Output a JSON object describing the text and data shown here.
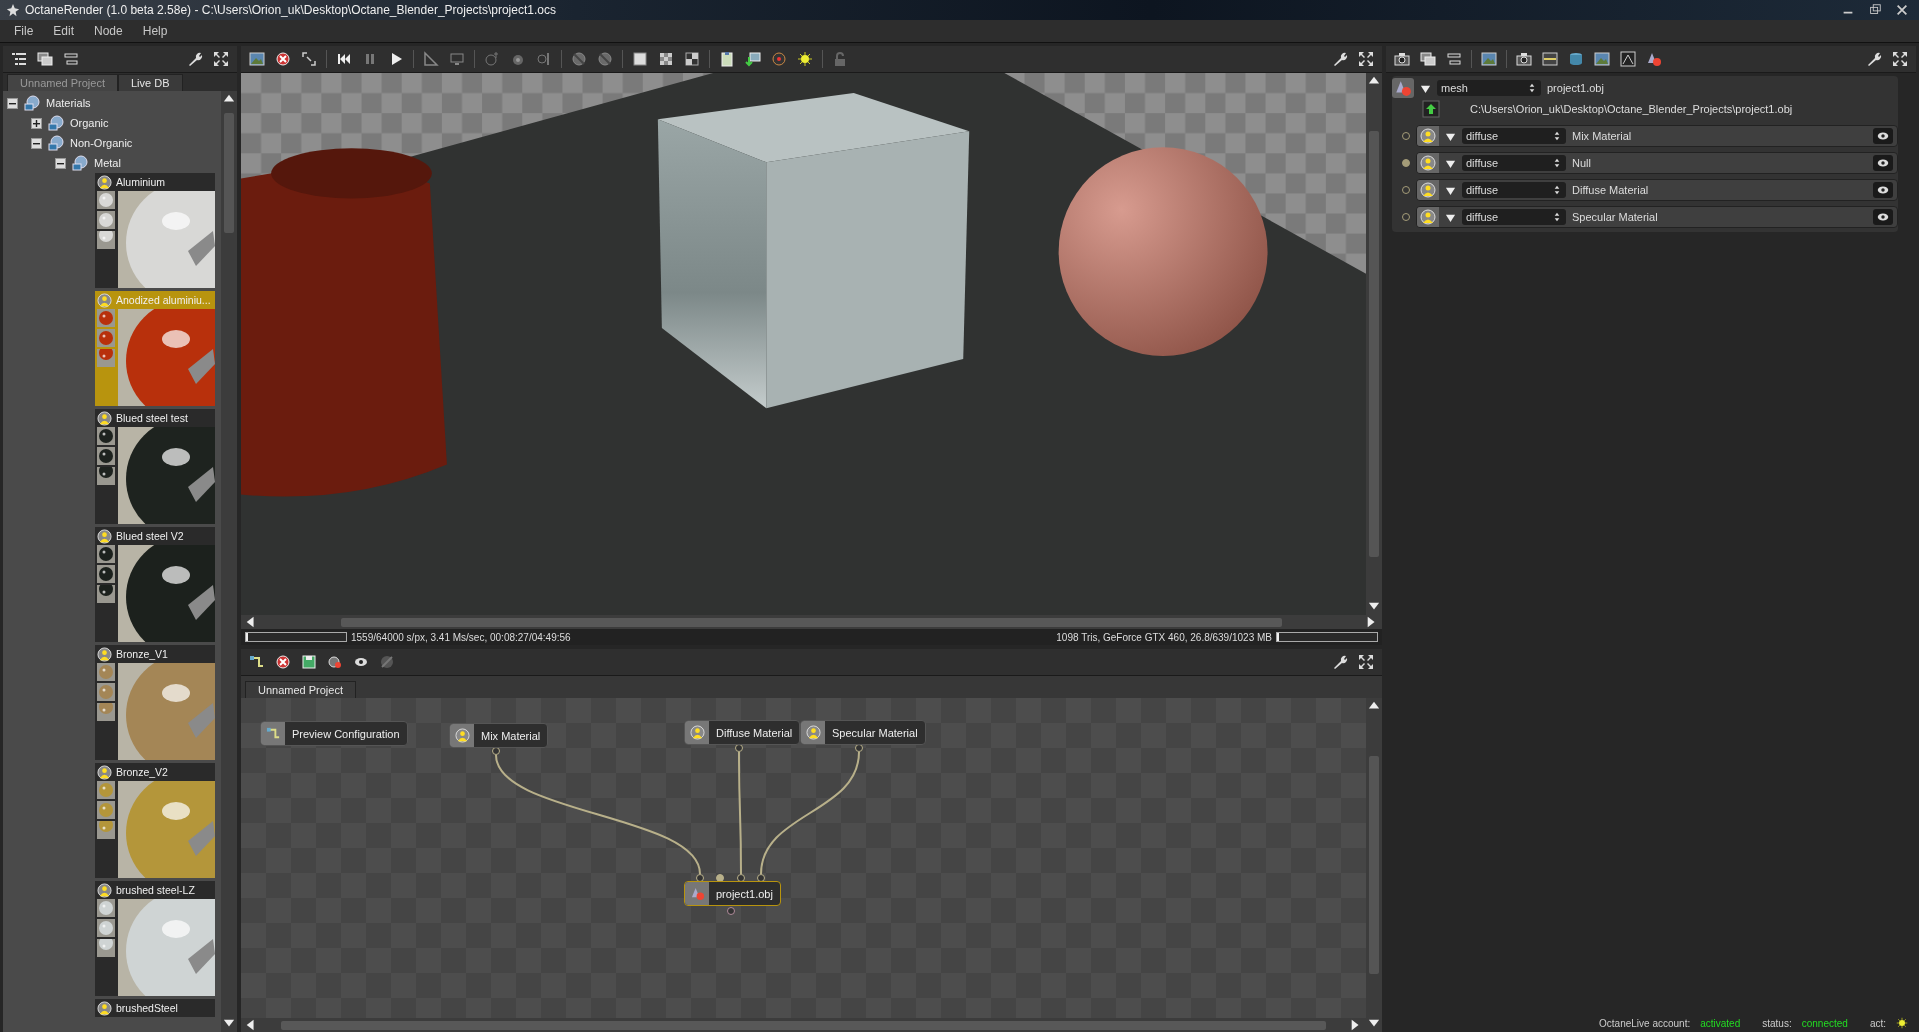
{
  "window": {
    "title": "OctaneRender (1.0 beta 2.58e) - C:\\Users\\Orion_uk\\Desktop\\Octane_Blender_Projects\\project1.ocs"
  },
  "menu": [
    "File",
    "Edit",
    "Node",
    "Help"
  ],
  "library": {
    "tabs": [
      {
        "label": "Unnamed Project",
        "selected": false
      },
      {
        "label": "Live DB",
        "selected": true
      }
    ],
    "tree": [
      {
        "label": "Materials",
        "expanded": true,
        "children": [
          {
            "label": "Organic",
            "expanded": false
          },
          {
            "label": "Non-Organic",
            "expanded": true,
            "children": [
              {
                "label": "Metal",
                "expanded": true
              }
            ]
          }
        ]
      }
    ],
    "materials": [
      {
        "name": "Aluminium",
        "selected": false,
        "color": "#d8d8d6"
      },
      {
        "name": "Anodized aluminiu...",
        "selected": true,
        "color": "#b8300c"
      },
      {
        "name": "Blued steel test",
        "selected": false,
        "color": "#1e231f"
      },
      {
        "name": "Blued steel V2",
        "selected": false,
        "color": "#1c211d"
      },
      {
        "name": "Bronze_V1",
        "selected": false,
        "color": "#a48656"
      },
      {
        "name": "Bronze_V2",
        "selected": false,
        "color": "#b4963a"
      },
      {
        "name": "brushed steel-LZ",
        "selected": false,
        "color": "#cfd4d4"
      },
      {
        "name": "brushedSteel",
        "selected": false
      }
    ]
  },
  "viewport": {
    "status_left": "1559/64000 s/px, 3.41 Ms/sec, 00:08:27/04:49:56",
    "status_right": "1098 Tris, GeForce GTX 460, 26.8/639/1023 MB",
    "progress": {
      "level": 0.02
    },
    "memory": {
      "level": 0.02
    }
  },
  "node_editor": {
    "tabs": [
      {
        "label": "Unnamed Project",
        "selected": true
      }
    ],
    "nodes": [
      {
        "label": "Preview Configuration",
        "kind": "config",
        "selected": false,
        "connected": false
      },
      {
        "label": "Mix Material",
        "kind": "material",
        "selected": false,
        "connected": true
      },
      {
        "label": "Diffuse Material",
        "kind": "material",
        "selected": false,
        "connected": true
      },
      {
        "label": "Specular Material",
        "kind": "material",
        "selected": false,
        "connected": true
      },
      {
        "label": "project1.obj",
        "kind": "mesh",
        "selected": true,
        "connected": false,
        "sockets": [
          {
            "connected": true
          },
          {
            "connected": false
          },
          {
            "connected": true
          },
          {
            "connected": true
          }
        ]
      }
    ]
  },
  "inspector": {
    "node_type": "mesh",
    "node_name": "project1.obj",
    "file_path": "C:\\Users\\Orion_uk\\Desktop\\Octane_Blender_Projects\\project1.obj",
    "pins": [
      {
        "type": "diffuse",
        "value": "Mix Material",
        "filled": false
      },
      {
        "type": "diffuse",
        "value": "Null",
        "filled": true
      },
      {
        "type": "diffuse",
        "value": "Diffuse Material",
        "filled": false
      },
      {
        "type": "diffuse",
        "value": "Specular Material",
        "filled": false
      }
    ]
  },
  "status_bar": {
    "account_label": "OctaneLive account:",
    "account_value": "activated",
    "status_label": "status:",
    "status_value": "connected",
    "act_label": "act:"
  }
}
